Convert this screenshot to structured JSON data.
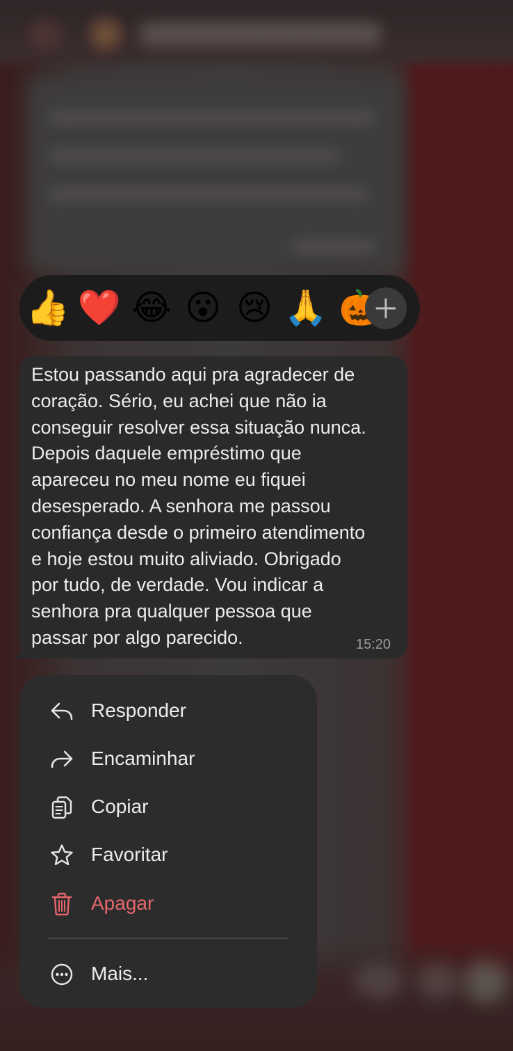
{
  "reactions": {
    "items": [
      {
        "emoji": "👍",
        "name": "thumbs-up"
      },
      {
        "emoji": "❤️",
        "name": "red-heart"
      },
      {
        "emoji": "😂",
        "name": "tears-of-joy"
      },
      {
        "emoji": "😮",
        "name": "surprised"
      },
      {
        "emoji": "😢",
        "name": "crying"
      },
      {
        "emoji": "🙏",
        "name": "folded-hands"
      },
      {
        "emoji": "🎃",
        "name": "partially-hidden-emoji"
      }
    ],
    "more_icon": "plus-icon"
  },
  "message": {
    "text": "Estou passando aqui pra agradecer de\ncoração. Sério, eu achei que não ia\nconseguir resolver essa situação nunca.\nDepois daquele empréstimo que\napareceu no meu nome eu fiquei\ndesesperado. A senhora me passou\nconfiança desde o primeiro atendimento\ne hoje estou muito aliviado. Obrigado\npor tudo, de verdade. Vou indicar a\nsenhora pra qualquer pessoa que\npassar por algo parecido.",
    "time": "15:20"
  },
  "menu": {
    "reply": {
      "label": "Responder",
      "icon": "reply-icon"
    },
    "forward": {
      "label": "Encaminhar",
      "icon": "forward-icon"
    },
    "copy": {
      "label": "Copiar",
      "icon": "copy-icon"
    },
    "star": {
      "label": "Favoritar",
      "icon": "star-icon"
    },
    "delete": {
      "label": "Apagar",
      "icon": "trash-icon"
    },
    "more": {
      "label": "Mais...",
      "icon": "more-icon"
    }
  },
  "colors": {
    "danger": "#e5676c",
    "menu_bg": "#2c2c2d",
    "bubble_bg": "#2a2a2a",
    "reaction_bar_bg": "#1c1c1c"
  }
}
